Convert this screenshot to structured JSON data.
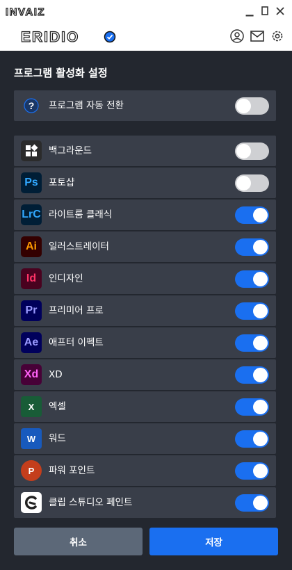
{
  "window": {
    "brand": "INVAIZ",
    "logo": "ERIDIO"
  },
  "heading": "프로그램 활성화 설정",
  "auto_switch": {
    "label": "프로그램 자동 전환",
    "on": false
  },
  "apps": [
    {
      "icon": "background-icon",
      "glyph": "",
      "label": "백그라운드",
      "on": false,
      "bg": "#2b2b2b",
      "fg": "#ffffff"
    },
    {
      "icon": "photoshop-icon",
      "glyph": "Ps",
      "label": "포토샵",
      "on": false,
      "bg": "#001e36",
      "fg": "#31a8ff"
    },
    {
      "icon": "lightroom-classic-icon",
      "glyph": "LrC",
      "label": "라이트룸 클래식",
      "on": true,
      "bg": "#001e36",
      "fg": "#31a8ff"
    },
    {
      "icon": "illustrator-icon",
      "glyph": "Ai",
      "label": "일러스트레이터",
      "on": true,
      "bg": "#330000",
      "fg": "#ff9a00"
    },
    {
      "icon": "indesign-icon",
      "glyph": "Id",
      "label": "인디자인",
      "on": true,
      "bg": "#49021f",
      "fg": "#ff3366"
    },
    {
      "icon": "premiere-pro-icon",
      "glyph": "Pr",
      "label": "프리미어 프로",
      "on": true,
      "bg": "#00005b",
      "fg": "#9999ff"
    },
    {
      "icon": "after-effects-icon",
      "glyph": "Ae",
      "label": "애프터 이펙트",
      "on": true,
      "bg": "#00005b",
      "fg": "#9999ff"
    },
    {
      "icon": "xd-icon",
      "glyph": "Xd",
      "label": "XD",
      "on": true,
      "bg": "#470137",
      "fg": "#ff61f6"
    },
    {
      "icon": "excel-icon",
      "glyph": "X",
      "label": "엑셀",
      "on": true,
      "bg": "#185c37",
      "fg": "#ffffff"
    },
    {
      "icon": "word-icon",
      "glyph": "W",
      "label": "워드",
      "on": true,
      "bg": "#185abd",
      "fg": "#ffffff"
    },
    {
      "icon": "powerpoint-icon",
      "glyph": "P",
      "label": "파워 포인트",
      "on": true,
      "bg": "#c43e1c",
      "fg": "#ffffff"
    },
    {
      "icon": "clip-studio-paint-icon",
      "glyph": "",
      "label": "클립 스튜디오 페인트",
      "on": true,
      "bg": "#ffffff",
      "fg": "#222222"
    }
  ],
  "buttons": {
    "cancel": "취소",
    "save": "저장"
  },
  "colors": {
    "accent": "#1a6ff0",
    "toggle_off": "#cfd0d3",
    "row_bg": "#393e49",
    "page_bg": "#23272f"
  }
}
